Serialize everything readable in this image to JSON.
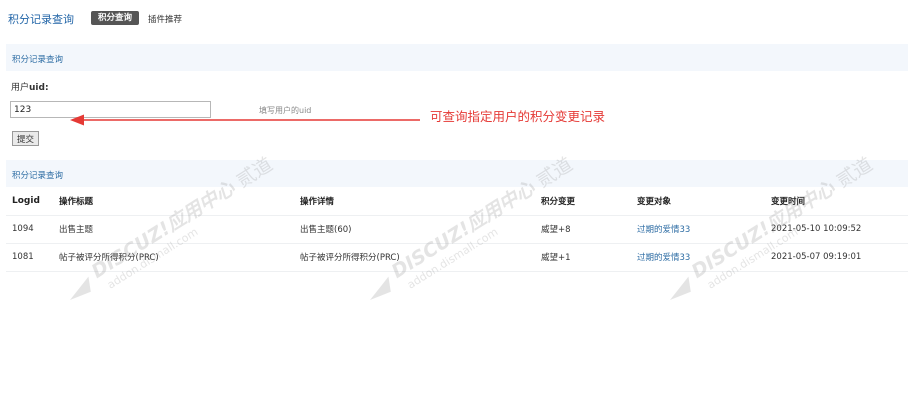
{
  "topbar": {
    "title": "积分记录查询",
    "tab_active": "积分查询",
    "tab_plugin": "插件推荐"
  },
  "search_section": {
    "heading": "积分记录查询",
    "uid_label": "用户",
    "uid_label_bold": "uid:",
    "uid_value": "123",
    "uid_hint": "填写用户的uid",
    "submit_label": "提交"
  },
  "annotation": {
    "text": "可查询指定用户的积分变更记录",
    "color": "#e53935"
  },
  "results_section": {
    "heading": "积分记录查询",
    "columns": [
      "Logid",
      "操作标题",
      "操作详情",
      "积分变更",
      "变更对象",
      "变更时间"
    ],
    "rows": [
      [
        "1094",
        "出售主题",
        "出售主题(60)",
        "威望+8",
        "过期的爱情33",
        "2021-05-10 10:09:52"
      ],
      [
        "1081",
        "帖子被评分所得积分(PRC)",
        "帖子被评分所得积分(PRC)",
        "威望+1",
        "过期的爱情33",
        "2021-05-07 09:19:01"
      ]
    ]
  },
  "watermark": {
    "brand": "DISCUZ!应用中心",
    "domain": "addon.dismall.com",
    "mark": "贰道"
  },
  "colors": {
    "link": "#2e6da4",
    "section_bg": "#f3f7fc",
    "tab_active_bg": "#555555"
  }
}
